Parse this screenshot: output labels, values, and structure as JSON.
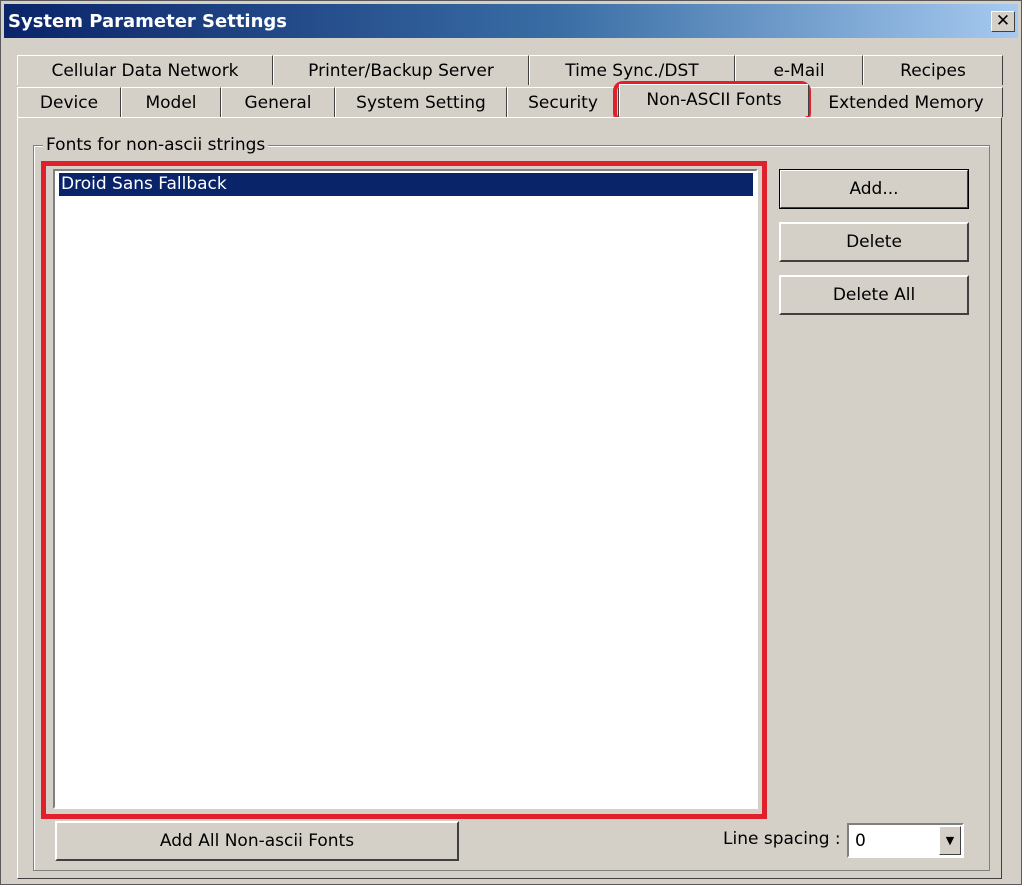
{
  "window": {
    "title": "System Parameter Settings",
    "close_label": "✕"
  },
  "tabs_row1": [
    {
      "label": "Cellular Data Network"
    },
    {
      "label": "Printer/Backup Server"
    },
    {
      "label": "Time Sync./DST"
    },
    {
      "label": "e-Mail"
    },
    {
      "label": "Recipes"
    }
  ],
  "tabs_row2": [
    {
      "label": "Device"
    },
    {
      "label": "Model"
    },
    {
      "label": "General"
    },
    {
      "label": "System Setting"
    },
    {
      "label": "Security"
    },
    {
      "label": "Non-ASCII Fonts",
      "active": true
    },
    {
      "label": "Extended Memory"
    }
  ],
  "fonts_group": {
    "legend": "Fonts for non-ascii strings",
    "items": [
      "Droid Sans Fallback"
    ],
    "selected_index": 0
  },
  "buttons": {
    "add": "Add...",
    "delete": "Delete",
    "delete_all": "Delete All",
    "add_all": "Add All Non-ascii Fonts"
  },
  "line_spacing": {
    "label": "Line spacing :",
    "value": "0"
  },
  "colors": {
    "highlight": "#e0202a",
    "selection": "#0a246a"
  },
  "icons": {
    "combo_arrow": "chevron-down-icon",
    "close": "close-icon"
  }
}
